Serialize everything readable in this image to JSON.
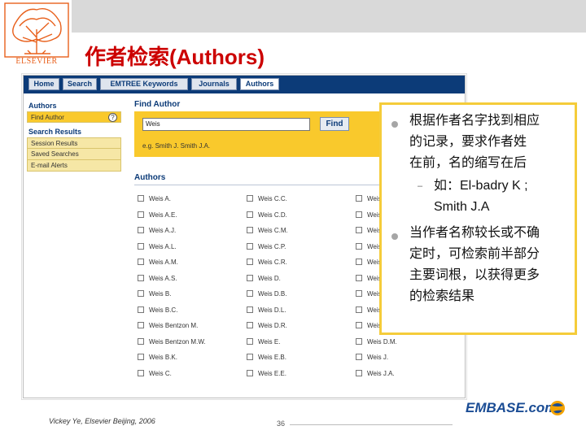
{
  "brand": {
    "logo_text": "ELSEVIER",
    "product_logo": "EMBASE.com",
    "accent": "#cc0000",
    "highlight": "#f9c92c",
    "nav_blue": "#0c3b78"
  },
  "slide": {
    "title": "作者检索(Authors)"
  },
  "screenshot": {
    "nav_tabs": [
      "Home",
      "Search",
      "EMTREE Keywords",
      "Journals",
      "Authors"
    ],
    "active_tab": "Authors",
    "sidebar": {
      "section1": "Authors",
      "item_find_author": "Find Author",
      "section2": "Search Results",
      "results_items": [
        "Session Results",
        "Saved Searches",
        "E-mail Alerts"
      ]
    },
    "find": {
      "title": "Find Author",
      "input_value": "Weis",
      "button_label": "Find",
      "example": "e.g. Smith J. Smith J.A."
    },
    "authors": {
      "heading": "Authors",
      "col1": [
        "Weis A.",
        "Weis A.E.",
        "Weis A.J.",
        "Weis A.L.",
        "Weis A.M.",
        "Weis A.S.",
        "Weis B.",
        "Weis B.C.",
        "Weis Bentzon M.",
        "Weis Bentzon M.W.",
        "Weis B.K.",
        "Weis C."
      ],
      "col2": [
        "Weis C.C.",
        "Weis C.D.",
        "Weis C.M.",
        "Weis C.P.",
        "Weis C.R.",
        "Weis D.",
        "Weis D.B.",
        "Weis D.L.",
        "Weis D.R.",
        "Weis E.",
        "Weis E.B.",
        "Weis E.E."
      ],
      "col3": [
        "Weis",
        "Weis",
        "Weis",
        "Weis",
        "Weis",
        "Weis",
        "Weis",
        "Weis",
        "Weis",
        "Weis D.M.",
        "Weis J.",
        "Weis J.A."
      ]
    }
  },
  "callout": {
    "bullet1_lines": [
      "根据作者名字找到相应",
      "的记录，要求作者姓",
      "在前，名的缩写在后"
    ],
    "example_lines": [
      "如：El-badry K ;",
      "Smith J.A"
    ],
    "bullet2_lines": [
      "当作者名称较长或不确",
      "定时，可检索前半部分",
      "主要词根，以获得更多",
      "的检索结果"
    ]
  },
  "footer": {
    "credit": "Vickey Ye, Elsevier Beijing, 2006",
    "page": "36"
  }
}
